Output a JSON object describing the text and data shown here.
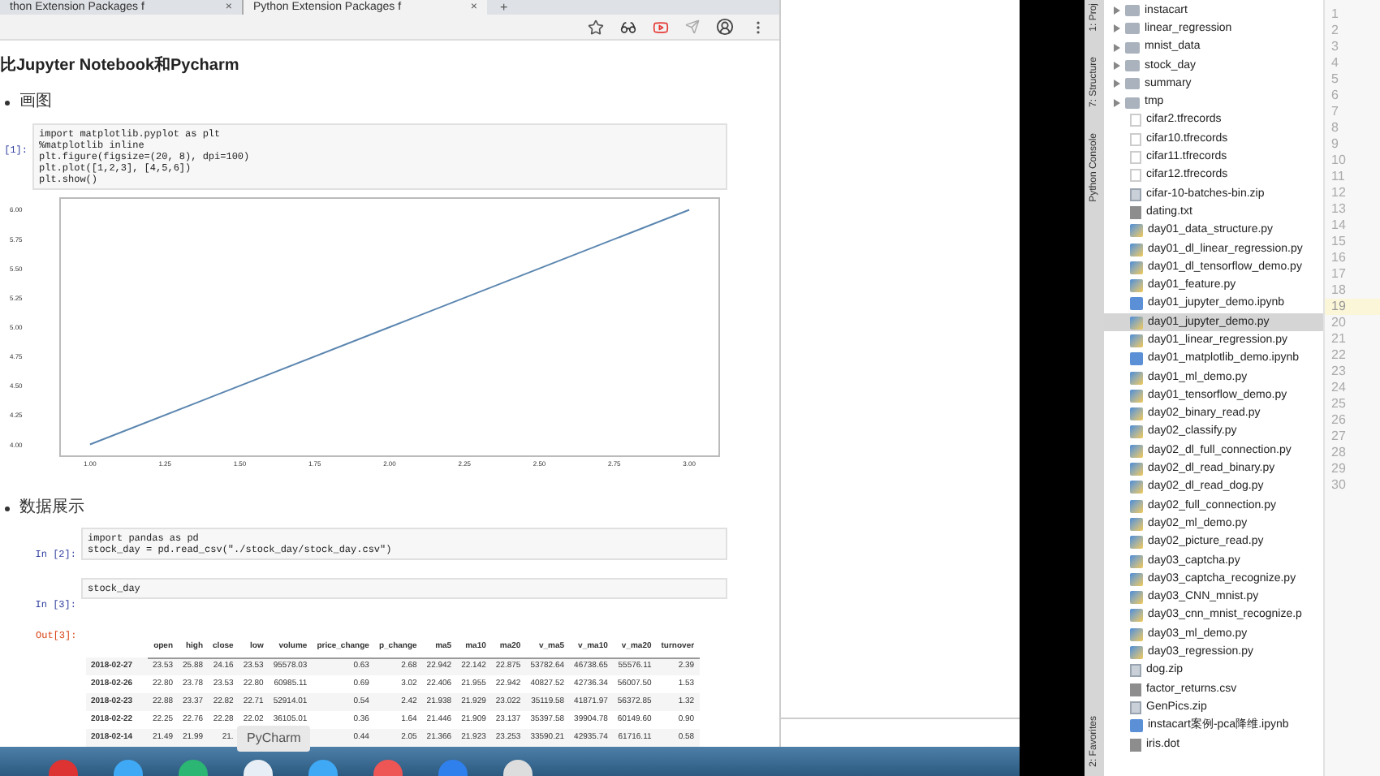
{
  "browser": {
    "tabs": [
      {
        "title": "thon Extension Packages f",
        "close": "×",
        "selected": false
      },
      {
        "title": "Python Extension Packages f",
        "close": "×",
        "selected": true
      }
    ],
    "new_tab": "+"
  },
  "notebook": {
    "heading": "比Jupyter Notebook和Pycharm",
    "sections": [
      {
        "bullet": "画图",
        "cells": [
          {
            "prompt": "[1]:",
            "code": [
              "import matplotlib.pyplot as plt",
              "%matplotlib inline",
              "plt.figure(figsize=(20, 8), dpi=100)",
              "plt.plot([1,2,3], [4,5,6])",
              "plt.show()"
            ],
            "output": {
              "kind": "chart",
              "chart_data": {
                "type": "line",
                "x": [
                  1,
                  2,
                  3
                ],
                "series": [
                  {
                    "color": "#5b86b0",
                    "values": [
                      4,
                      5,
                      6
                    ]
                  }
                ],
                "xlim": [
                  0.9,
                  3.1
                ],
                "ylim": [
                  3.9,
                  6.1
                ],
                "xticks": [
                  {
                    "value": 1,
                    "label": "1.00"
                  },
                  {
                    "value": 1.25,
                    "label": "1.25"
                  },
                  {
                    "value": 1.5,
                    "label": "1.50"
                  },
                  {
                    "value": 1.75,
                    "label": "1.75"
                  },
                  {
                    "value": 2,
                    "label": "2.00"
                  },
                  {
                    "value": 2.25,
                    "label": "2.25"
                  },
                  {
                    "value": 2.5,
                    "label": "2.50"
                  },
                  {
                    "value": 2.75,
                    "label": "2.75"
                  },
                  {
                    "value": 3,
                    "label": "3.00"
                  }
                ],
                "yticks": [
                  {
                    "value": 4,
                    "label": "4.00"
                  },
                  {
                    "value": 4.25,
                    "label": "4.25"
                  },
                  {
                    "value": 4.5,
                    "label": "4.50"
                  },
                  {
                    "value": 4.75,
                    "label": "4.75"
                  },
                  {
                    "value": 5,
                    "label": "5.00"
                  },
                  {
                    "value": 5.25,
                    "label": "5.25"
                  },
                  {
                    "value": 5.5,
                    "label": "5.50"
                  },
                  {
                    "value": 5.75,
                    "label": "5.75"
                  },
                  {
                    "value": 6,
                    "label": "6.00"
                  }
                ]
              }
            }
          }
        ]
      },
      {
        "bullet": "数据展示",
        "cells": [
          {
            "prompt": "In [2]:",
            "code": [
              "import pandas as pd",
              "stock_day = pd.read_csv(\"./stock_day/stock_day.csv\")"
            ]
          },
          {
            "prompt": "In [3]:",
            "code": [
              "stock_day"
            ],
            "out_prompt": "Out[3]:",
            "output": {
              "kind": "table",
              "columns": [
                "open",
                "high",
                "close",
                "low",
                "volume",
                "price_change",
                "p_change",
                "ma5",
                "ma10",
                "ma20",
                "v_ma5",
                "v_ma10",
                "v_ma20",
                "turnover"
              ],
              "rows": [
                {
                  "index": "2018-02-27",
                  "cells": [
                    "23.53",
                    "25.88",
                    "24.16",
                    "23.53",
                    "95578.03",
                    "0.63",
                    "2.68",
                    "22.942",
                    "22.142",
                    "22.875",
                    "53782.64",
                    "46738.65",
                    "55576.11",
                    "2.39"
                  ]
                },
                {
                  "index": "2018-02-26",
                  "cells": [
                    "22.80",
                    "23.78",
                    "23.53",
                    "22.80",
                    "60985.11",
                    "0.69",
                    "3.02",
                    "22.406",
                    "21.955",
                    "22.942",
                    "40827.52",
                    "42736.34",
                    "56007.50",
                    "1.53"
                  ]
                },
                {
                  "index": "2018-02-23",
                  "cells": [
                    "22.88",
                    "23.37",
                    "22.82",
                    "22.71",
                    "52914.01",
                    "0.54",
                    "2.42",
                    "21.938",
                    "21.929",
                    "23.022",
                    "35119.58",
                    "41871.97",
                    "56372.85",
                    "1.32"
                  ]
                },
                {
                  "index": "2018-02-22",
                  "cells": [
                    "22.25",
                    "22.76",
                    "22.28",
                    "22.02",
                    "36105.01",
                    "0.36",
                    "1.64",
                    "21.446",
                    "21.909",
                    "23.137",
                    "35397.58",
                    "39904.78",
                    "60149.60",
                    "0.90"
                  ]
                },
                {
                  "index": "2018-02-14",
                  "cells": [
                    "21.49",
                    "21.99",
                    "21.",
                    null,
                    null,
                    "0.44",
                    "2.05",
                    "21.366",
                    "21.923",
                    "23.253",
                    "33590.21",
                    "42935.74",
                    "61716.11",
                    "0.58"
                  ]
                }
              ]
            }
          }
        ]
      }
    ]
  },
  "dock": {
    "tooltip": "PyCharm"
  },
  "pycharm": {
    "tool_tabs": [
      "1: Proj",
      "7: Structure",
      "Python Console",
      "2: Favorites"
    ],
    "tree": [
      {
        "name": "instacart",
        "kind": "folder",
        "expanded": false,
        "selected": false
      },
      {
        "name": "linear_regression",
        "kind": "folder",
        "expanded": false,
        "selected": false
      },
      {
        "name": "mnist_data",
        "kind": "folder",
        "expanded": false,
        "selected": false
      },
      {
        "name": "stock_day",
        "kind": "folder",
        "expanded": false,
        "selected": false
      },
      {
        "name": "summary",
        "kind": "folder",
        "expanded": false,
        "selected": false
      },
      {
        "name": "tmp",
        "kind": "folder",
        "expanded": false,
        "selected": false
      },
      {
        "name": "cifar2.tfrecords",
        "kind": "plain",
        "selected": false
      },
      {
        "name": "cifar10.tfrecords",
        "kind": "plain",
        "selected": false
      },
      {
        "name": "cifar11.tfrecords",
        "kind": "plain",
        "selected": false
      },
      {
        "name": "cifar12.tfrecords",
        "kind": "plain",
        "selected": false
      },
      {
        "name": "cifar-10-batches-bin.zip",
        "kind": "archive",
        "selected": false
      },
      {
        "name": "dating.txt",
        "kind": "text",
        "selected": false
      },
      {
        "name": "day01_data_structure.py",
        "kind": "python",
        "selected": false
      },
      {
        "name": "day01_dl_linear_regression.py",
        "kind": "python",
        "selected": false
      },
      {
        "name": "day01_dl_tensorflow_demo.py",
        "kind": "python",
        "selected": false
      },
      {
        "name": "day01_feature.py",
        "kind": "python",
        "selected": false
      },
      {
        "name": "day01_jupyter_demo.ipynb",
        "kind": "notebook",
        "selected": false
      },
      {
        "name": "day01_jupyter_demo.py",
        "kind": "python",
        "selected": true
      },
      {
        "name": "day01_linear_regression.py",
        "kind": "python",
        "selected": false
      },
      {
        "name": "day01_matplotlib_demo.ipynb",
        "kind": "notebook",
        "selected": false
      },
      {
        "name": "day01_ml_demo.py",
        "kind": "python",
        "selected": false
      },
      {
        "name": "day01_tensorflow_demo.py",
        "kind": "python",
        "selected": false
      },
      {
        "name": "day02_binary_read.py",
        "kind": "python",
        "selected": false
      },
      {
        "name": "day02_classify.py",
        "kind": "python",
        "selected": false
      },
      {
        "name": "day02_dl_full_connection.py",
        "kind": "python",
        "selected": false
      },
      {
        "name": "day02_dl_read_binary.py",
        "kind": "python",
        "selected": false
      },
      {
        "name": "day02_dl_read_dog.py",
        "kind": "python",
        "selected": false
      },
      {
        "name": "day02_full_connection.py",
        "kind": "python",
        "selected": false
      },
      {
        "name": "day02_ml_demo.py",
        "kind": "python",
        "selected": false
      },
      {
        "name": "day02_picture_read.py",
        "kind": "python",
        "selected": false
      },
      {
        "name": "day03_captcha.py",
        "kind": "python",
        "selected": false
      },
      {
        "name": "day03_captcha_recognize.py",
        "kind": "python",
        "selected": false
      },
      {
        "name": "day03_CNN_mnist.py",
        "kind": "python",
        "selected": false
      },
      {
        "name": "day03_cnn_mnist_recognize.p",
        "kind": "python",
        "selected": false
      },
      {
        "name": "day03_ml_demo.py",
        "kind": "python",
        "selected": false
      },
      {
        "name": "day03_regression.py",
        "kind": "python",
        "selected": false
      },
      {
        "name": "dog.zip",
        "kind": "archive",
        "selected": false
      },
      {
        "name": "factor_returns.csv",
        "kind": "text",
        "selected": false
      },
      {
        "name": "GenPics.zip",
        "kind": "archive",
        "selected": false
      },
      {
        "name": "instacart案例-pca降维.ipynb",
        "kind": "notebook",
        "selected": false
      },
      {
        "name": "iris.dot",
        "kind": "text",
        "selected": false
      }
    ],
    "lines": [
      {
        "n": "1",
        "current": false
      },
      {
        "n": "2",
        "current": false
      },
      {
        "n": "3",
        "current": false
      },
      {
        "n": "4",
        "current": false
      },
      {
        "n": "5",
        "current": false
      },
      {
        "n": "6",
        "current": false
      },
      {
        "n": "7",
        "current": false
      },
      {
        "n": "8",
        "current": false
      },
      {
        "n": "9",
        "current": false
      },
      {
        "n": "10",
        "current": false
      },
      {
        "n": "11",
        "current": false
      },
      {
        "n": "12",
        "current": false
      },
      {
        "n": "13",
        "current": false
      },
      {
        "n": "14",
        "current": false
      },
      {
        "n": "15",
        "current": false
      },
      {
        "n": "16",
        "current": false
      },
      {
        "n": "17",
        "current": false
      },
      {
        "n": "18",
        "current": false
      },
      {
        "n": "19",
        "current": true
      },
      {
        "n": "20",
        "current": false
      },
      {
        "n": "21",
        "current": false
      },
      {
        "n": "22",
        "current": false
      },
      {
        "n": "23",
        "current": false
      },
      {
        "n": "24",
        "current": false
      },
      {
        "n": "25",
        "current": false
      },
      {
        "n": "26",
        "current": false
      },
      {
        "n": "27",
        "current": false
      },
      {
        "n": "28",
        "current": false
      },
      {
        "n": "29",
        "current": false
      },
      {
        "n": "30",
        "current": false
      }
    ]
  }
}
